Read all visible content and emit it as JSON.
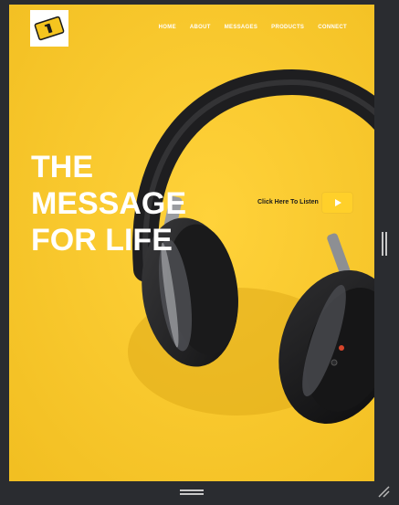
{
  "nav": {
    "items": [
      "HOME",
      "ABOUT",
      "MESSAGES",
      "PRODUCTS",
      "CONNECT"
    ]
  },
  "hero": {
    "headline_lines": [
      "THE",
      "MESSAGE",
      "FOR LIFE"
    ],
    "listen_label": "Click Here To Listen"
  },
  "colors": {
    "background": "#f7c72b",
    "button": "#ffd02a",
    "frame": "#2a2c30"
  },
  "icons": {
    "logo": "ticket-logo-icon",
    "play": "play-icon",
    "resize": "resize-corner-icon"
  }
}
